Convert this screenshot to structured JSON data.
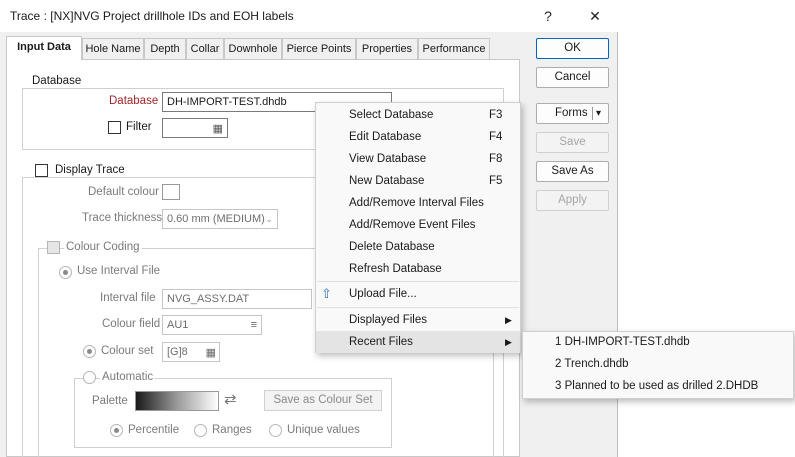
{
  "window": {
    "title": "Trace : [NX]NVG Project drillhole IDs and EOH labels",
    "help": "?",
    "close": "✕"
  },
  "tabs": [
    "Input Data",
    "Hole Name",
    "Depth",
    "Collar",
    "Downhole",
    "Pierce Points",
    "Properties",
    "Performance"
  ],
  "buttons": {
    "ok": "OK",
    "cancel": "Cancel",
    "forms": "Forms",
    "forms_arrow": "▾",
    "save": "Save",
    "save_as": "Save As",
    "apply": "Apply"
  },
  "database": {
    "group_label": "Database",
    "db_label": "Database",
    "db_value": "DH-IMPORT-TEST.dhdb",
    "filter_label": "Filter",
    "filter_value": ""
  },
  "display_trace": {
    "label": "Display Trace",
    "default_colour_label": "Default colour",
    "thickness_label": "Trace thickness",
    "thickness_value": "0.60 mm (MEDIUM)",
    "colour_coding_label": "Colour Coding",
    "use_interval_label": "Use Interval File",
    "interval_file_label": "Interval file",
    "interval_file_value": "NVG_ASSY.DAT",
    "colour_field_label": "Colour field",
    "colour_field_value": "AU1",
    "colour_set_label": "Colour set",
    "colour_set_value": "[G]8",
    "automatic_label": "Automatic",
    "palette_label": "Palette",
    "save_colour_set": "Save as Colour Set",
    "percentile": "Percentile",
    "ranges": "Ranges",
    "unique_values": "Unique values"
  },
  "context_menu": {
    "items": [
      {
        "label": "Select Database",
        "shortcut": "F3"
      },
      {
        "label": "Edit Database",
        "shortcut": "F4"
      },
      {
        "label": "View Database",
        "shortcut": "F8"
      },
      {
        "label": "New Database",
        "shortcut": "F5"
      },
      {
        "label": "Add/Remove Interval Files",
        "shortcut": ""
      },
      {
        "label": "Add/Remove Event Files",
        "shortcut": ""
      },
      {
        "label": "Delete Database",
        "shortcut": ""
      },
      {
        "label": "Refresh Database",
        "shortcut": ""
      },
      {
        "label": "Upload File...",
        "shortcut": ""
      },
      {
        "label": "Displayed Files",
        "shortcut": ""
      },
      {
        "label": "Recent Files",
        "shortcut": ""
      }
    ],
    "submenu_arrow": "▶"
  },
  "recent_files": [
    "1 DH-IMPORT-TEST.dhdb",
    "2 Trench.dhdb",
    "3 Planned to be used as drilled 2.DHDB"
  ]
}
